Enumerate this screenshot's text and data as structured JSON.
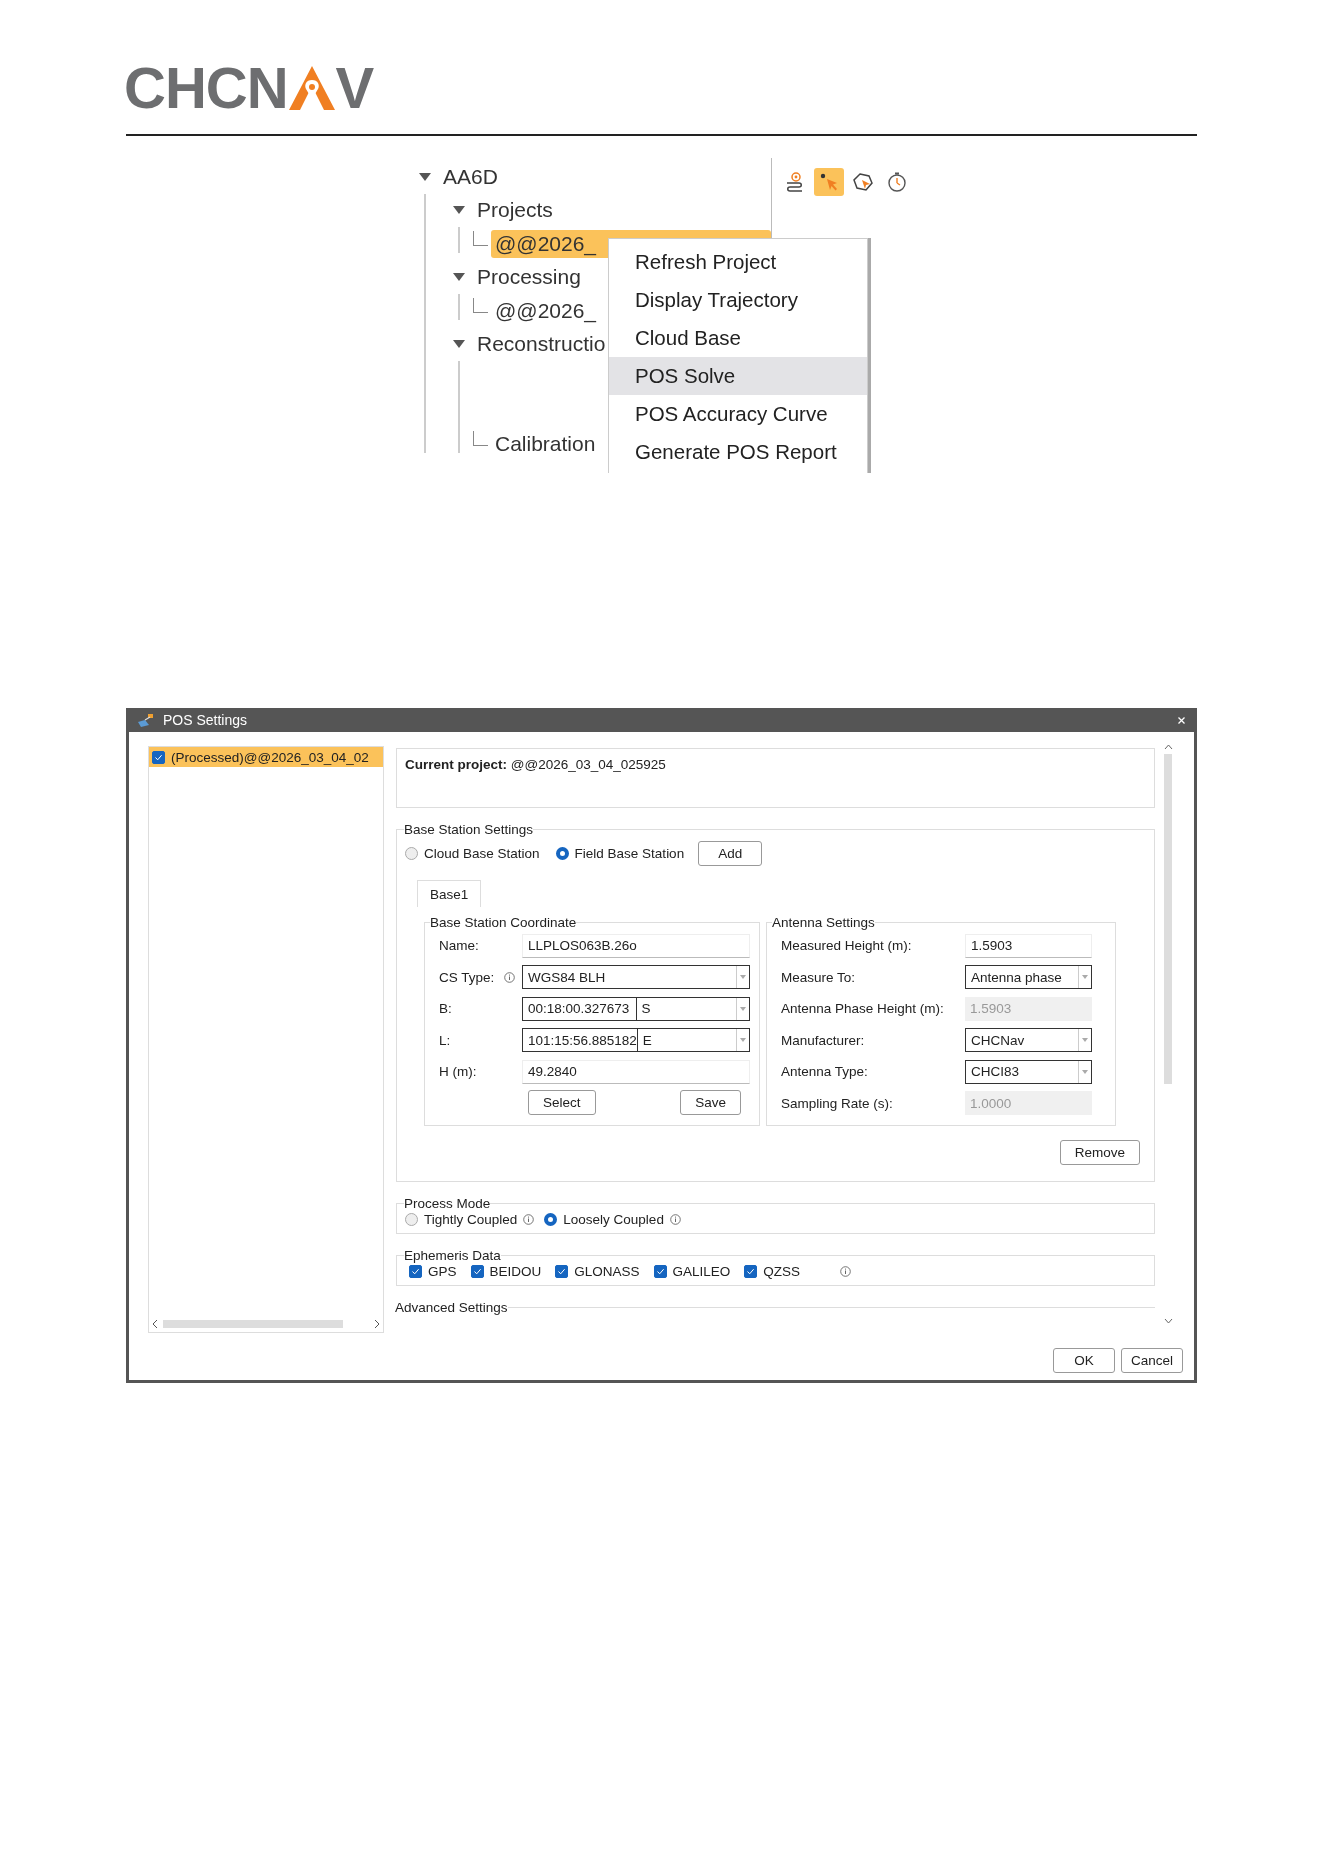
{
  "logo": {
    "left": "CHCN",
    "right": "V"
  },
  "tree": [
    {
      "label": "AA6D",
      "expanded": true,
      "children": [
        {
          "label": "Projects",
          "expanded": true,
          "children": [
            {
              "label": "@@2026_",
              "selected": true
            }
          ]
        },
        {
          "label": "Processing",
          "expanded": true,
          "children": [
            {
              "label": "@@2026_",
              "selected": false
            }
          ]
        },
        {
          "label": "Reconstructio",
          "expanded": true,
          "children": [
            {
              "label": "Calibration",
              "selected": false
            }
          ]
        }
      ]
    }
  ],
  "tools": [
    {
      "kind": "trajectory",
      "selected": false
    },
    {
      "kind": "point",
      "selected": true
    },
    {
      "kind": "polygon",
      "selected": false
    },
    {
      "kind": "timer",
      "selected": false
    }
  ],
  "context_menu": [
    {
      "label": "Refresh Project",
      "highlighted": false
    },
    {
      "label": "Display Trajectory",
      "highlighted": false
    },
    {
      "label": "Cloud Base",
      "highlighted": false
    },
    {
      "label": "POS Solve",
      "highlighted": true
    },
    {
      "label": "POS Accuracy Curve",
      "highlighted": false
    },
    {
      "label": "Generate POS Report",
      "highlighted": false
    }
  ],
  "dialog": {
    "title": "POS Settings",
    "project_list": [
      {
        "label": "(Processed)@@2026_03_04_02",
        "checked": true,
        "selected": true
      }
    ],
    "current_project": {
      "label": "Current project:",
      "value": "@@2026_03_04_025925"
    },
    "base_station": {
      "title": "Base Station Settings",
      "sources": [
        {
          "label": "Cloud Base Station",
          "selected": false
        },
        {
          "label": "Field Base Station",
          "selected": true
        }
      ],
      "add_button": "Add",
      "tabs": [
        {
          "label": "Base1",
          "selected": true
        }
      ],
      "coordinate": {
        "title": "Base Station Coordinate",
        "fields": [
          {
            "kind": "text",
            "label": "Name:",
            "value": "LLPLOS063B.26o"
          },
          {
            "kind": "dropdown",
            "label": "CS Type:",
            "info": true,
            "value": "WGS84 BLH"
          },
          {
            "kind": "hemisphere",
            "label": "B:",
            "value": "00:18:00.327673",
            "suffix": "S"
          },
          {
            "kind": "hemisphere",
            "label": "L:",
            "value": "101:15:56.885182",
            "suffix": "E"
          },
          {
            "kind": "text",
            "label": "H (m):",
            "value": "49.2840"
          }
        ],
        "buttons": [
          "Select",
          "Save"
        ]
      },
      "antenna": {
        "title": "Antenna Settings",
        "fields": [
          {
            "kind": "text",
            "label": "Measured Height (m):",
            "value": "1.5903"
          },
          {
            "kind": "dropdown",
            "label": "Measure To:",
            "value": "Antenna phase"
          },
          {
            "kind": "readonly",
            "label": "Antenna Phase Height (m):",
            "value": "1.5903"
          },
          {
            "kind": "dropdown",
            "label": "Manufacturer:",
            "value": "CHCNav"
          },
          {
            "kind": "dropdown",
            "label": "Antenna Type:",
            "value": "CHCI83"
          },
          {
            "kind": "readonly",
            "label": "Sampling Rate (s):",
            "value": "1.0000"
          }
        ]
      },
      "remove_button": "Remove"
    },
    "process_mode": {
      "title": "Process Mode",
      "options": [
        {
          "label": "Tightly Coupled",
          "selected": false,
          "info": true
        },
        {
          "label": "Loosely Coupled",
          "selected": true,
          "info": true
        }
      ]
    },
    "ephemeris": {
      "title": "Ephemeris Data",
      "info": true,
      "systems": [
        {
          "label": "GPS",
          "checked": true
        },
        {
          "label": "BEIDOU",
          "checked": true
        },
        {
          "label": "GLONASS",
          "checked": true
        },
        {
          "label": "GALILEO",
          "checked": true
        },
        {
          "label": "QZSS",
          "checked": true
        }
      ]
    },
    "advanced": {
      "title": "Advanced Settings"
    },
    "buttons": [
      "OK",
      "Cancel"
    ]
  }
}
